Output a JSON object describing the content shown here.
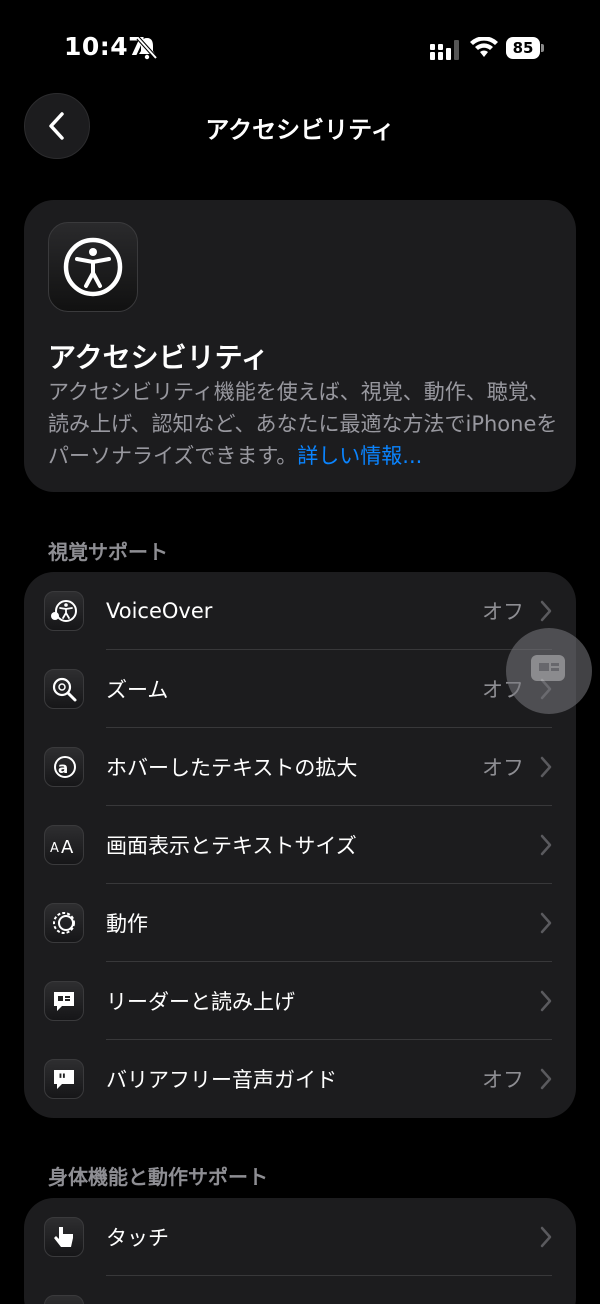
{
  "status": {
    "time": "10:47",
    "battery": "85"
  },
  "nav": {
    "title": "アクセシビリティ"
  },
  "header": {
    "title": "アクセシビリティ",
    "description": "アクセシビリティ機能を使えば、視覚、動作、聴覚、読み上げ、認知など、あなたに最適な方法でiPhoneをパーソナライズできます。",
    "link": "詳しい情報..."
  },
  "vision": {
    "section_title": "視覚サポート",
    "items": [
      {
        "label": "VoiceOver",
        "value": "オフ",
        "icon": "voiceover-icon"
      },
      {
        "label": "ズーム",
        "value": "オフ",
        "icon": "zoom-icon"
      },
      {
        "label": "ホバーしたテキストの拡大",
        "value": "オフ",
        "icon": "hover-text-icon"
      },
      {
        "label": "画面表示とテキストサイズ",
        "value": "",
        "icon": "text-size-icon"
      },
      {
        "label": "動作",
        "value": "",
        "icon": "motion-icon"
      },
      {
        "label": "リーダーと読み上げ",
        "value": "",
        "icon": "reader-icon"
      },
      {
        "label": "バリアフリー音声ガイド",
        "value": "オフ",
        "icon": "audio-description-icon"
      }
    ]
  },
  "physical": {
    "section_title": "身体機能と動作サポート",
    "items": [
      {
        "label": "タッチ",
        "value": "",
        "icon": "touch-icon"
      }
    ]
  },
  "colors": {
    "accent": "#0a84ff",
    "card": "#1c1c1e",
    "secondary_text": "#8e8e93"
  }
}
